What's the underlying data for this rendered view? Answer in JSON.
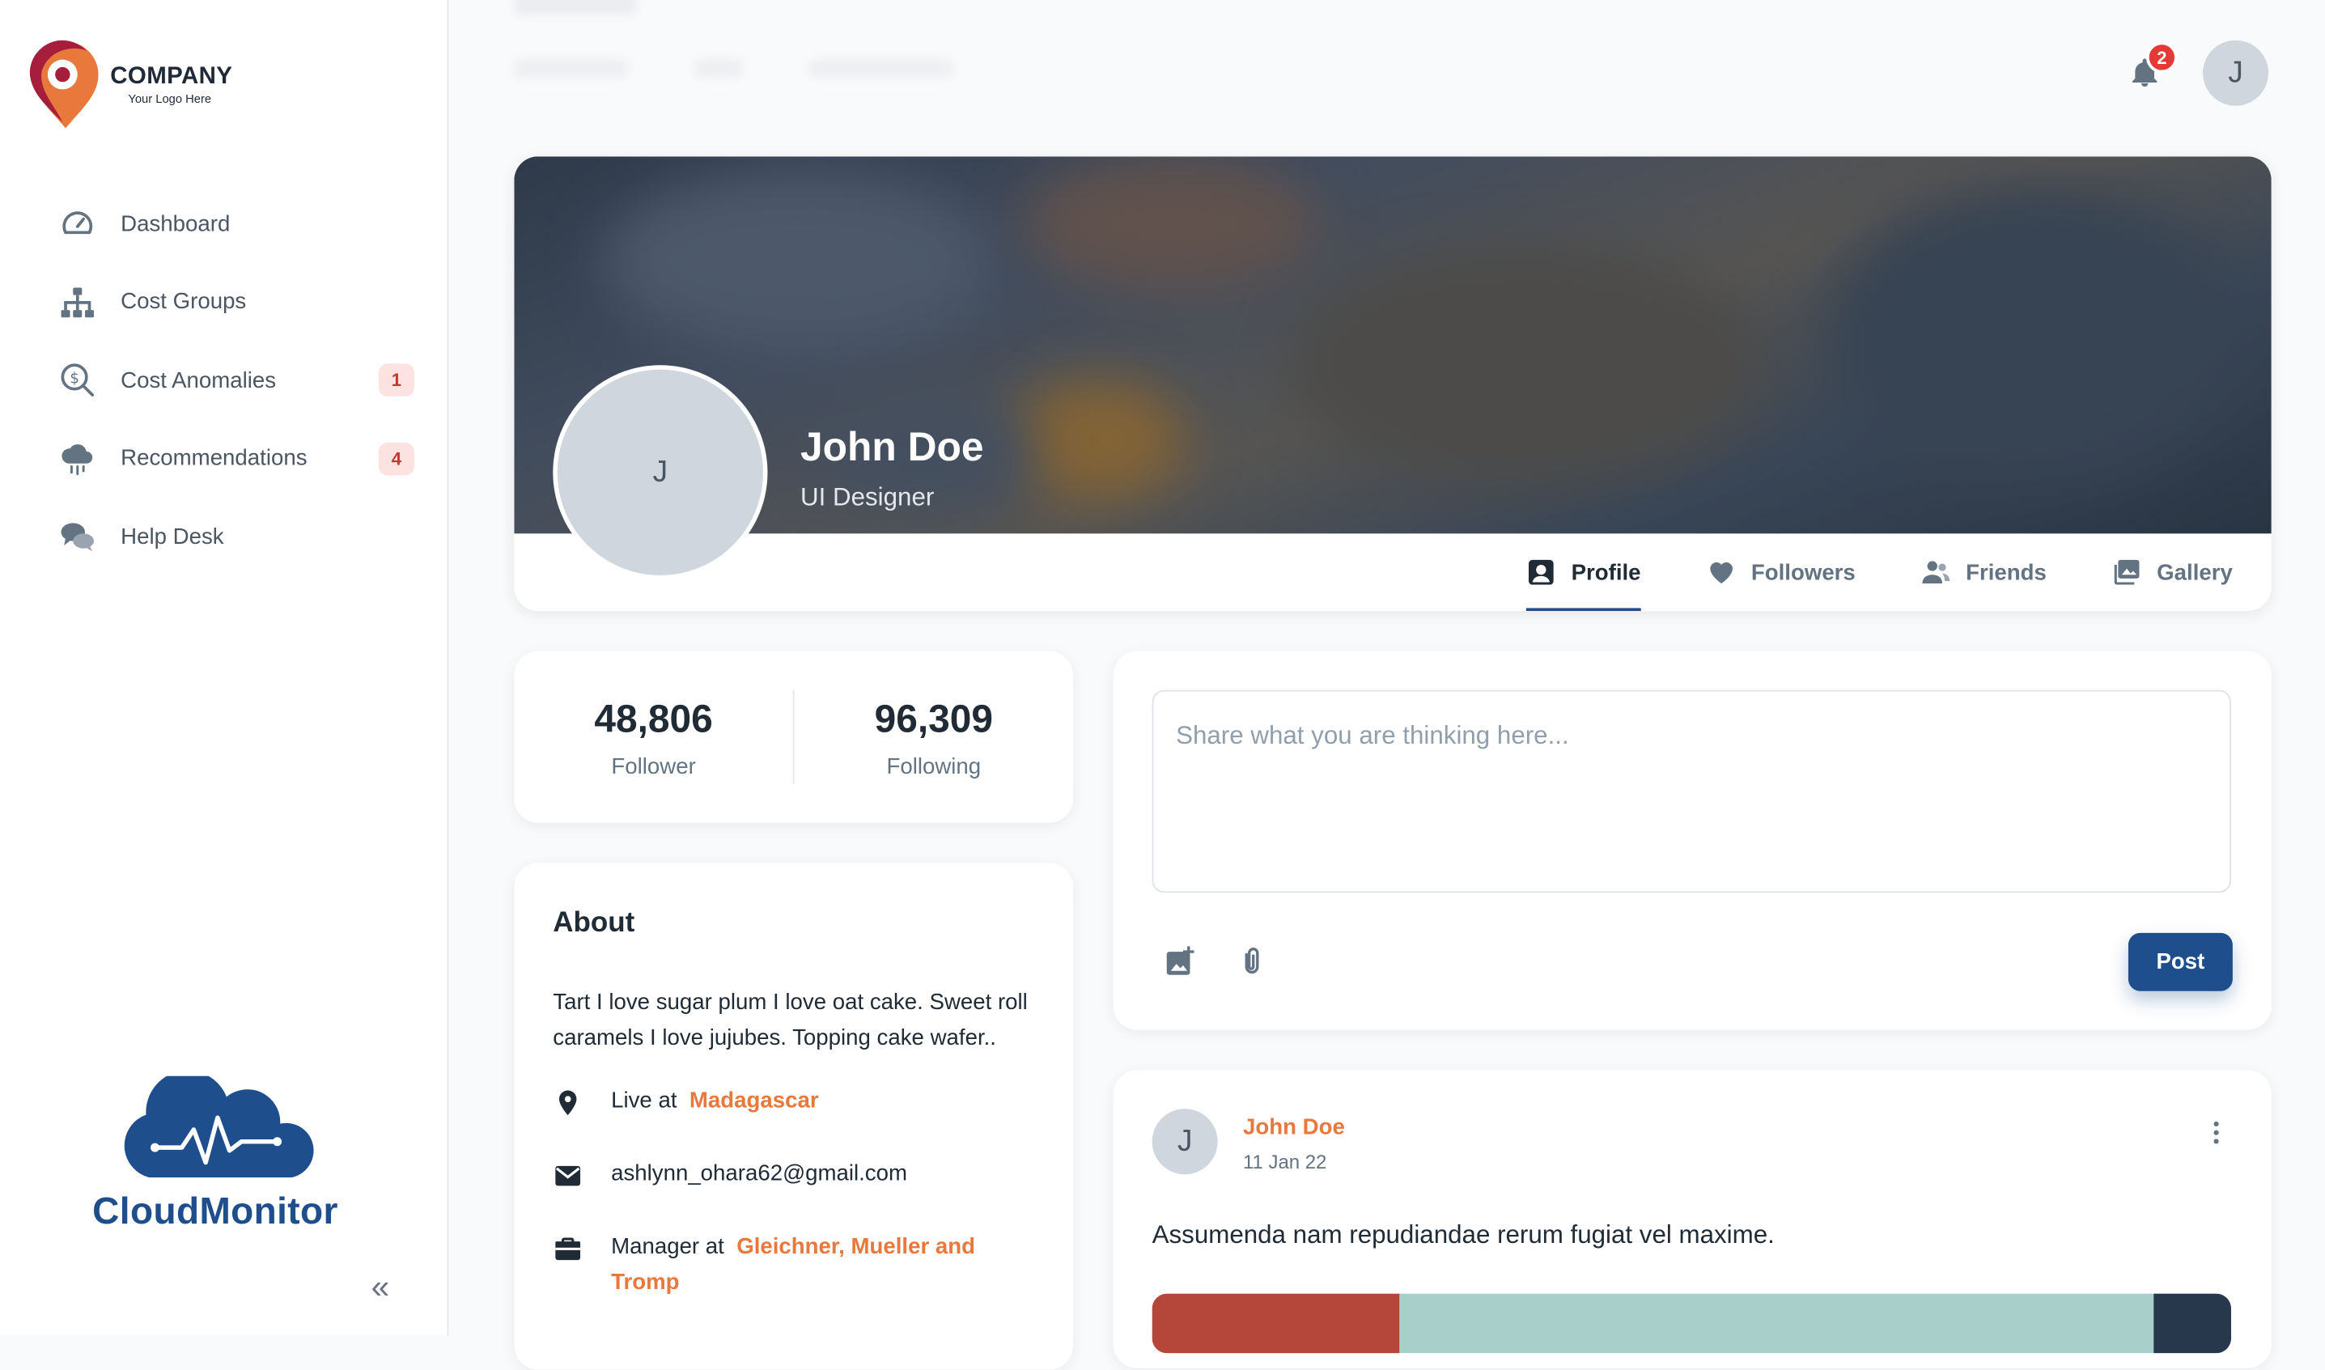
{
  "brand": {
    "name": "COMPANY",
    "tagline": "Your Logo Here",
    "accent": "#e8783c",
    "primary": "#1e4f8c"
  },
  "sidebar": {
    "items": [
      {
        "label": "Dashboard",
        "icon": "speedometer-icon"
      },
      {
        "label": "Cost Groups",
        "icon": "hierarchy-icon"
      },
      {
        "label": "Cost Anomalies",
        "icon": "dollar-search-icon",
        "badge": "1"
      },
      {
        "label": "Recommendations",
        "icon": "cloud-rain-icon",
        "badge": "4"
      },
      {
        "label": "Help Desk",
        "icon": "chat-bubbles-icon"
      }
    ],
    "footer_logo": "CloudMonitor",
    "collapse_icon": "double-chevron-left-icon"
  },
  "header": {
    "notifications_count": "2",
    "avatar_initial": "J"
  },
  "profile": {
    "avatar_initial": "J",
    "name": "John Doe",
    "role": "UI Designer",
    "tabs": [
      {
        "label": "Profile",
        "icon": "id-badge-icon",
        "active": true
      },
      {
        "label": "Followers",
        "icon": "heart-icon"
      },
      {
        "label": "Friends",
        "icon": "people-icon"
      },
      {
        "label": "Gallery",
        "icon": "images-icon"
      }
    ]
  },
  "stats": {
    "follower_value": "48,806",
    "follower_label": "Follower",
    "following_value": "96,309",
    "following_label": "Following"
  },
  "about": {
    "title": "About",
    "text": "Tart I love sugar plum I love oat cake. Sweet roll caramels I love jujubes. Topping cake wafer..",
    "live_prefix": "Live at",
    "live_value": "Madagascar",
    "email": "ashlynn_ohara62@gmail.com",
    "work_prefix": "Manager at",
    "work_value": "Gleichner, Mueller and Tromp"
  },
  "composer": {
    "placeholder": "Share what you are thinking here...",
    "post_label": "Post"
  },
  "post": {
    "avatar_initial": "J",
    "author": "John Doe",
    "date": "11 Jan 22",
    "body": "Assumenda nam repudiandae rerum fugiat vel maxime."
  }
}
